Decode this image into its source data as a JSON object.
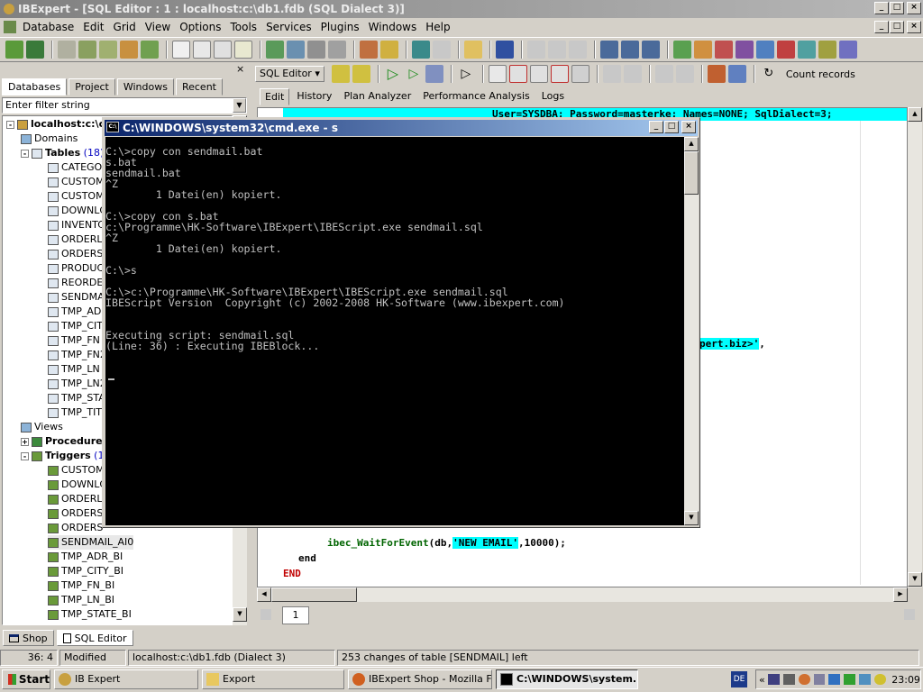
{
  "app": {
    "title": "IBExpert - [SQL Editor : 1 : localhost:c:\\db1.fdb (SQL Dialect 3)]"
  },
  "menu": [
    "Database",
    "Edit",
    "Grid",
    "View",
    "Options",
    "Tools",
    "Services",
    "Plugins",
    "Windows",
    "Help"
  ],
  "left_panel": {
    "tabs": [
      "Databases",
      "Project",
      "Windows",
      "Recent"
    ],
    "active_tab": "Databases",
    "filter_placeholder": "Enter filter string",
    "tree": [
      {
        "label": "localhost:c:\\c",
        "bold": true,
        "icon": "db",
        "indent": 0,
        "expander": "-"
      },
      {
        "label": "Domains",
        "icon": "fold",
        "indent": 1
      },
      {
        "label": "Tables",
        "count": "(18)",
        "bold": true,
        "icon": "tbl",
        "indent": 1,
        "expander": "-"
      },
      {
        "label": "CATEGO",
        "icon": "tbl",
        "indent": 2
      },
      {
        "label": "CUSTOM",
        "icon": "tbl",
        "indent": 2
      },
      {
        "label": "CUSTOM",
        "icon": "tbl",
        "indent": 2
      },
      {
        "label": "DOWNLC",
        "icon": "tbl",
        "indent": 2
      },
      {
        "label": "INVENTC",
        "icon": "tbl",
        "indent": 2
      },
      {
        "label": "ORDERLI",
        "icon": "tbl",
        "indent": 2
      },
      {
        "label": "ORDERS",
        "icon": "tbl",
        "indent": 2
      },
      {
        "label": "PRODUC",
        "icon": "tbl",
        "indent": 2
      },
      {
        "label": "REORDE",
        "icon": "tbl",
        "indent": 2
      },
      {
        "label": "SENDMA",
        "icon": "tbl",
        "indent": 2
      },
      {
        "label": "TMP_ADI",
        "icon": "tbl",
        "indent": 2
      },
      {
        "label": "TMP_CIT",
        "icon": "tbl",
        "indent": 2
      },
      {
        "label": "TMP_FN",
        "icon": "tbl",
        "indent": 2
      },
      {
        "label": "TMP_FN2",
        "icon": "tbl",
        "indent": 2
      },
      {
        "label": "TMP_LN",
        "icon": "tbl",
        "indent": 2
      },
      {
        "label": "TMP_LN2",
        "icon": "tbl",
        "indent": 2
      },
      {
        "label": "TMP_STA",
        "icon": "tbl",
        "indent": 2
      },
      {
        "label": "TMP_TIT",
        "icon": "tbl",
        "indent": 2
      },
      {
        "label": "Views",
        "icon": "fold",
        "indent": 1
      },
      {
        "label": "Procedure",
        "bold": true,
        "icon": "proc",
        "indent": 1,
        "expander": "+"
      },
      {
        "label": "Triggers",
        "count": "(1",
        "bold": true,
        "icon": "trg",
        "indent": 1,
        "expander": "-"
      },
      {
        "label": "CUSTOM",
        "icon": "trg",
        "indent": 2
      },
      {
        "label": "DOWNLC",
        "icon": "trg",
        "indent": 2
      },
      {
        "label": "ORDERLI",
        "icon": "trg",
        "indent": 2
      },
      {
        "label": "ORDERS",
        "icon": "trg",
        "indent": 2
      },
      {
        "label": "ORDERS",
        "icon": "trg",
        "indent": 2
      },
      {
        "label": "SENDMAIL_AI0",
        "icon": "trg",
        "indent": 2,
        "selected": true
      },
      {
        "label": "TMP_ADR_BI",
        "icon": "trg",
        "indent": 2
      },
      {
        "label": "TMP_CITY_BI",
        "icon": "trg",
        "indent": 2
      },
      {
        "label": "TMP_FN_BI",
        "icon": "trg",
        "indent": 2
      },
      {
        "label": "TMP_LN_BI",
        "icon": "trg",
        "indent": 2
      },
      {
        "label": "TMP_STATE_BI",
        "icon": "trg",
        "indent": 2
      }
    ]
  },
  "sql_toolbar": {
    "combo": "SQL Editor",
    "count_records": "Count records"
  },
  "editor_tabs": [
    "Edit",
    "History",
    "Plan Analyzer",
    "Performance Analysis",
    "Logs"
  ],
  "editor": {
    "line_top": "User=SYSDBA; Password=masterke; Names=NONE; SqlDialect=3;",
    "line_mid": "pert.biz>'",
    "line_mid_tail": ",",
    "line_wait_fn": "ibec_WaitForEvent",
    "line_wait_open": "(db,",
    "line_wait_str": "'NEW EMAIL'",
    "line_wait_tail": ",10000);",
    "line_end": "end",
    "line_END": "END"
  },
  "page_tab": "1",
  "bottom_tabs": [
    "Shop",
    "SQL Editor"
  ],
  "status": {
    "pos": "36:   4",
    "state": "Modified",
    "db": "localhost:c:\\db1.fdb (Dialect 3)",
    "msg": "253 changes of table [SENDMAIL] left"
  },
  "cmd": {
    "title": "C:\\WINDOWS\\system32\\cmd.exe - s",
    "lines": [
      "C:\\>copy con sendmail.bat",
      "s.bat",
      "sendmail.bat",
      "^Z",
      "        1 Datei(en) kopiert.",
      "",
      "C:\\>copy con s.bat",
      "c:\\Programme\\HK-Software\\IBExpert\\IBEScript.exe sendmail.sql",
      "^Z",
      "        1 Datei(en) kopiert.",
      "",
      "C:\\>s",
      "",
      "C:\\>c:\\Programme\\HK-Software\\IBExpert\\IBEScript.exe sendmail.sql",
      "IBEScript Version  Copyright (c) 2002-2008 HK-Software (www.ibexpert.com)",
      "",
      "",
      "Executing script: sendmail.sql",
      "(Line: 36) : Executing IBEBlock..."
    ]
  },
  "taskbar": {
    "start": "Start",
    "tasks": [
      "IB Expert",
      "Export",
      "IBExpert Shop - Mozilla F...",
      "C:\\WINDOWS\\system..."
    ],
    "active_task": 3,
    "lang": "DE",
    "clock": "23:09"
  }
}
